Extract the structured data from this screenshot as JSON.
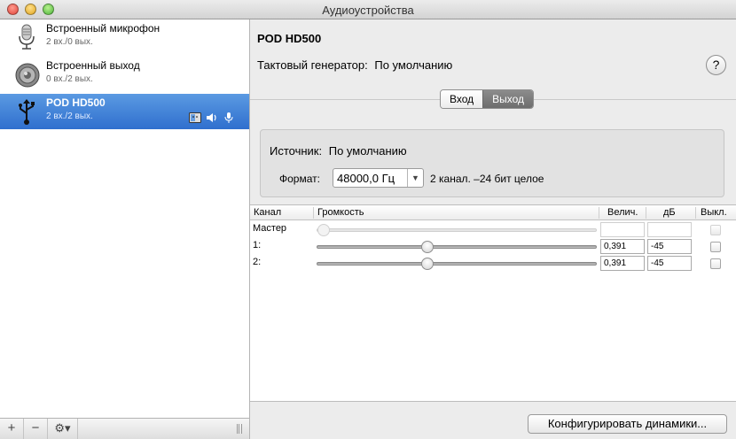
{
  "window": {
    "title": "Аудиоустройства"
  },
  "sidebar": {
    "devices": [
      {
        "name": "Встроенный микрофон",
        "io": "2 вх./0 вых.",
        "icon": "microphone-icon"
      },
      {
        "name": "Встроенный выход",
        "io": "0 вх./2 вых.",
        "icon": "speaker-icon"
      },
      {
        "name": "POD HD500",
        "io": "2 вх./2 вых.",
        "icon": "usb-icon",
        "selected": true,
        "badges": [
          "finder-icon",
          "volume-icon",
          "microphone-icon"
        ]
      }
    ],
    "footer": {
      "add": "+",
      "remove": "−",
      "gear": "⚙▾"
    }
  },
  "detail": {
    "device_title": "POD HD500",
    "clock_label": "Тактовый генератор:",
    "clock_value": "По умолчанию",
    "help": "?",
    "tabs": {
      "input": "Вход",
      "output": "Выход",
      "active": "output"
    },
    "source_label": "Источник:",
    "source_value": "По умолчанию",
    "format_label": "Формат:",
    "format_value": "48000,0 Гц",
    "format_info": "2 канал. –24 бит целое",
    "table": {
      "headers": {
        "channel": "Канал",
        "volume": "Громкость",
        "value": "Велич.",
        "db": "дБ",
        "mute": "Выкл."
      },
      "rows": [
        {
          "label": "Мастер",
          "level": 0,
          "value": "",
          "db": "",
          "disabled": true
        },
        {
          "label": "1:",
          "level": 0.391,
          "value": "0,391",
          "db": "-45",
          "disabled": false
        },
        {
          "label": "2:",
          "level": 0.391,
          "value": "0,391",
          "db": "-45",
          "disabled": false
        }
      ]
    },
    "configure_button": "Конфигурировать динамики..."
  }
}
